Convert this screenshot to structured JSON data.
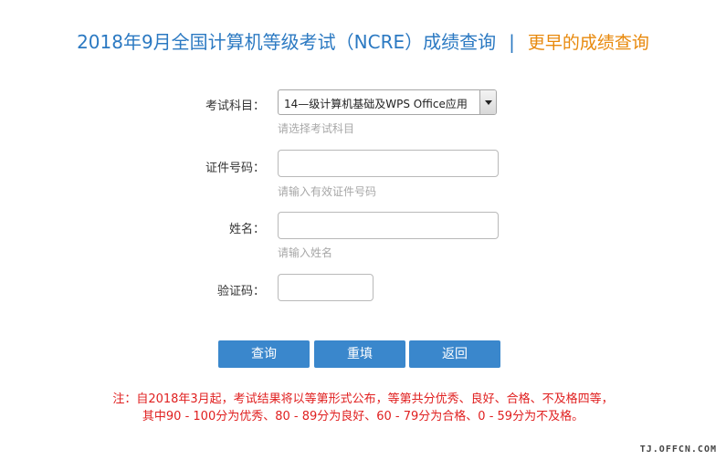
{
  "header": {
    "title": "2018年9月全国计算机等级考试（NCRE）成绩查询",
    "separator": "|",
    "earlier_link": "更早的成绩查询"
  },
  "form": {
    "subject": {
      "label": "考试科目：",
      "selected": "14—级计算机基础及WPS Office应用",
      "hint": "请选择考试科目"
    },
    "id_number": {
      "label": "证件号码：",
      "value": "",
      "hint": "请输入有效证件号码"
    },
    "name": {
      "label": "姓名：",
      "value": "",
      "hint": "请输入姓名"
    },
    "captcha": {
      "label": "验证码：",
      "value": ""
    }
  },
  "buttons": {
    "query": "查询",
    "reset": "重填",
    "back": "返回"
  },
  "note": {
    "line1": "注：自2018年3月起，考试结果将以等第形式公布，等第共分优秀、良好、合格、不及格四等，",
    "line2": "其中90 - 100分为优秀、80 - 89分为良好、60 - 79分为合格、0 - 59分为不及格。"
  },
  "watermark": "TJ.OFFCN.COM",
  "colors": {
    "title": "#2b79c2",
    "earlier_link": "#e8890c",
    "button": "#3a87cc",
    "note": "#e02020",
    "hint": "#a8a8a8"
  }
}
